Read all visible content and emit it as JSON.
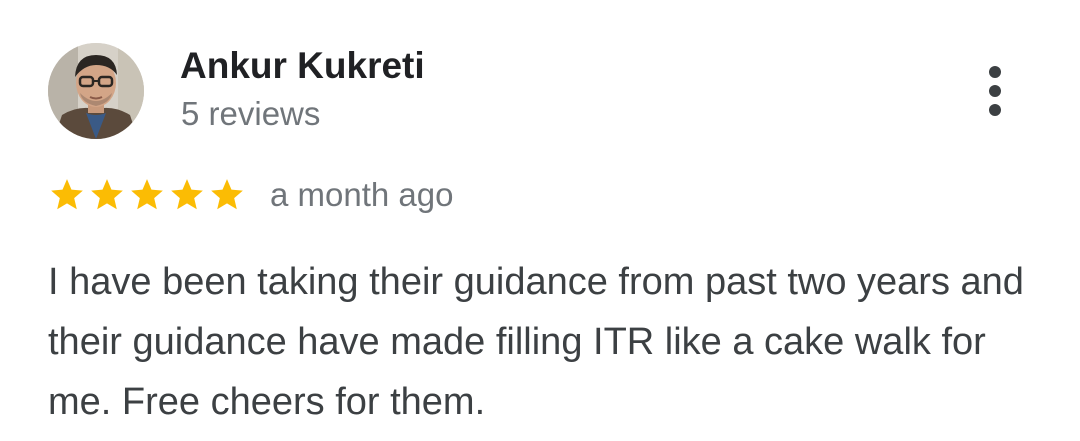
{
  "review": {
    "author_name": "Ankur Kukreti",
    "author_review_count": "5 reviews",
    "rating": 5,
    "rating_max": 5,
    "time_ago": "a month ago",
    "text": "I have been taking their guidance from past two years and their guidance have made filling ITR like a cake walk for me. Free cheers for them.",
    "avatar_icon": "user-photo-avatar",
    "more_icon": "more-vertical-icon",
    "star_icon": "star-icon"
  },
  "colors": {
    "star": "#fbbc04",
    "name": "#202124",
    "secondary_text": "#70757a",
    "body_text": "#3c4043"
  }
}
